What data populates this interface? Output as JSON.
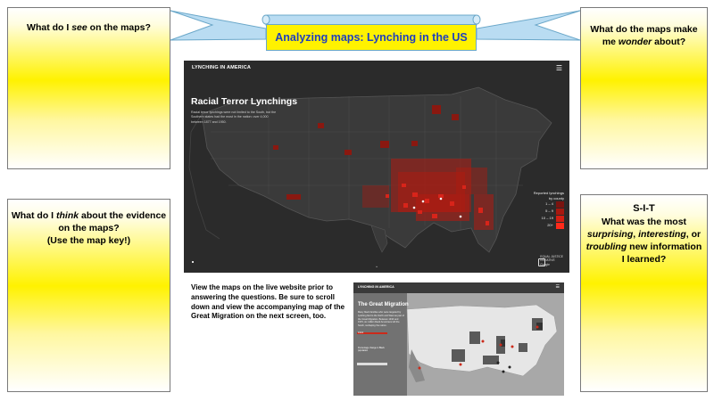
{
  "banner": {
    "title": "Analyzing maps: Lynching in the US"
  },
  "boxes": {
    "see": {
      "pre": "What do I ",
      "em": "see",
      "post": " on the maps?"
    },
    "wonder": {
      "l1": "What do the maps make",
      "pre": "me ",
      "em": "wonder",
      "post": " about?"
    },
    "think": {
      "pre": "What do I ",
      "em": "think",
      "post": " about the evidence",
      "l2": "on the maps?",
      "l3": "(Use the map key!)"
    },
    "sit": {
      "l1": "S-I-T",
      "l2": "What was the most",
      "em1": "surprising",
      "mid1": ", ",
      "em2": "interesting",
      "mid2": ", or",
      "em3": "troubling",
      "post3": " new information",
      "l5": "I learned?"
    }
  },
  "map1": {
    "brand": "LYNCHING IN AMERICA",
    "menu_icon": "menu-icon",
    "title": "Racial Terror Lynchings",
    "description": "Racial terror lynchings were not limited to the South, but the Southern states had the most in the nation: over 4,000 between 1877 and 1950.",
    "key": {
      "title": "Reported lynchings",
      "subtitle": "by county",
      "items": [
        {
          "label": "1 – 4",
          "color": "#7a1410"
        },
        {
          "label": "5 – 9",
          "color": "#a8180f"
        },
        {
          "label": "10 – 19",
          "color": "#d41e12"
        },
        {
          "label": "20+",
          "color": "#ff2a1a"
        }
      ]
    },
    "logo_text": {
      "l1": "EQUAL JUSTICE",
      "l2": "INITIATIVE",
      "l3": "Google"
    }
  },
  "instructions": "View the maps on the live website prior to answering the questions. Be sure to scroll down and view the accompanying map of the Great Migration on the next screen, too.",
  "map2": {
    "brand": "LYNCHING IN AMERICA",
    "menu_icon": "menu-icon",
    "panel_title": "The Great Migration",
    "panel_desc": "Many black families who were targeted by lynching fled to the North and West as part of the Great Migration. Between 1910 and 1970, six million black Americans left the South, reshaping the nation.",
    "year": "1910",
    "legend": "Percentage change in Black population"
  },
  "colors": {
    "banner_fill": "#fff200",
    "banner_text": "#1f3fbf",
    "map_bg": "#2b2b2b",
    "lynching_red": "#c01a10"
  }
}
